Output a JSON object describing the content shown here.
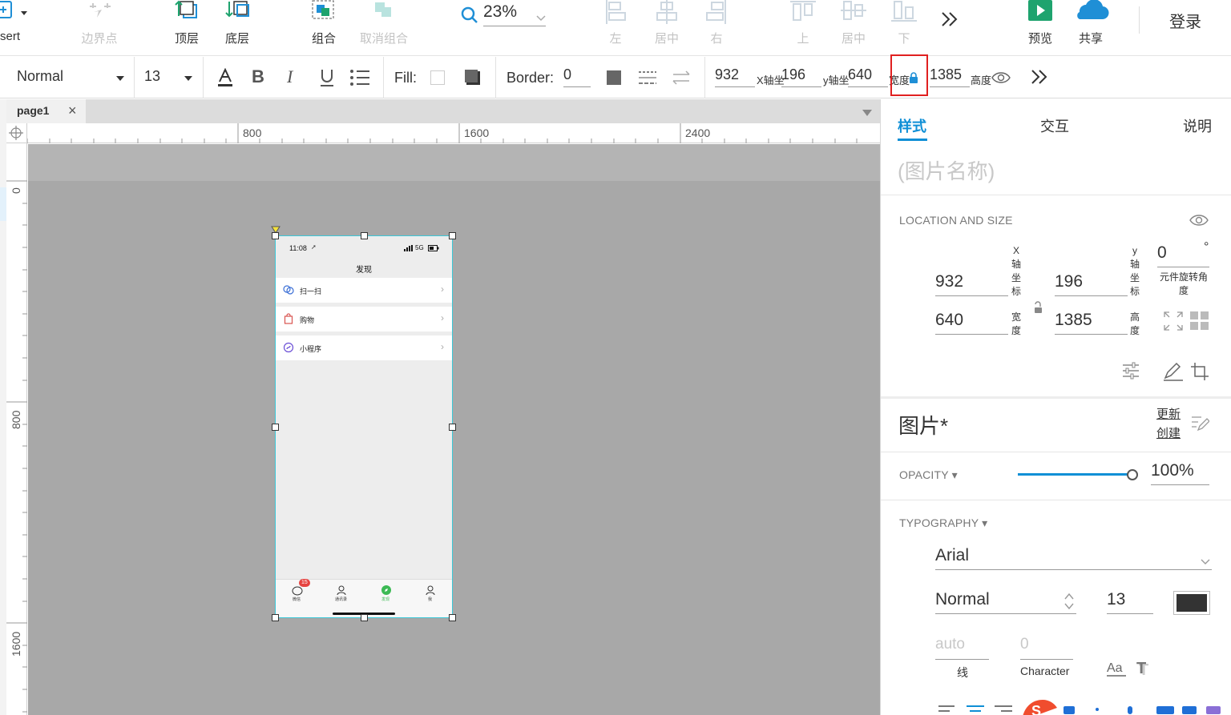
{
  "toolbar": {
    "insert_label": "sert",
    "boundary_label": "边界点",
    "top_layer_label": "顶层",
    "bottom_layer_label": "底层",
    "group_label": "组合",
    "ungroup_label": "取消组合",
    "zoom_value": "23%",
    "align_left_label": "左",
    "align_center_label": "居中",
    "align_right_label": "右",
    "align_top_label": "上",
    "align_middle_label": "居中",
    "align_bottom_label": "下",
    "preview_label": "预览",
    "share_label": "共享",
    "login_label": "登录"
  },
  "formatbar": {
    "style_value": "Normal",
    "font_size": "13",
    "fill_label": "Fill:",
    "border_label": "Border:",
    "border_value": "0",
    "x_value": "932",
    "x_label": "X轴坐",
    "y_value": "196",
    "y_label": "y轴坐",
    "w_value": "640",
    "w_label": "宽度",
    "h_value": "1385",
    "h_label": "高度"
  },
  "tabs": [
    {
      "label": "page1"
    }
  ],
  "rulers": {
    "top_labels": [
      "800",
      "1600",
      "2400"
    ],
    "left_labels": [
      "0",
      "800",
      "1600"
    ]
  },
  "phone": {
    "time": "11:08",
    "signal": "5G",
    "title": "发现",
    "rows": [
      "扫一扫",
      "购物",
      "小程序"
    ],
    "tabbar_badge": "15",
    "tabbar_labels": [
      "微信",
      "通讯录",
      "发现",
      "我"
    ]
  },
  "rpanel": {
    "tabs": {
      "style": "样式",
      "interact": "交互",
      "notes": "说明"
    },
    "name_placeholder": "(图片名称)",
    "location_caption": "LOCATION AND SIZE",
    "x_value": "932",
    "y_value": "196",
    "w_value": "640",
    "h_value": "1385",
    "x_vlabel": "X轴坐标",
    "y_vlabel": "y轴坐标",
    "w_vlabel": "宽度",
    "h_vlabel": "高度",
    "rotation_value": "0",
    "rotation_unit": "°",
    "rotation_label": "元件旋转角度",
    "image_title": "图片*",
    "update_link": "更新",
    "create_link": "创建",
    "opacity_caption": "OPACITY ▾",
    "opacity_value": "100%",
    "opacity_fraction": 1.0,
    "typography_caption": "TYPOGRAPHY ▾",
    "font_family": "Arial",
    "font_style": "Normal",
    "font_size": "13",
    "line_value": "auto",
    "line_label": "线",
    "char_value": "0",
    "char_label": "Character",
    "accent_color": "#0f8fd6"
  }
}
